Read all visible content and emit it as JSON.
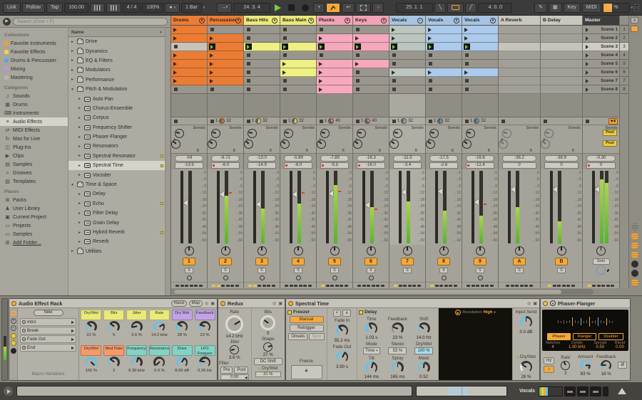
{
  "toolbar": {
    "link": "Link",
    "follow": "Follow",
    "tap": "Tap",
    "tempo": "100.00",
    "time_signature": "4 / 4",
    "groove_amount": "100%",
    "quantization": "1 Bar",
    "arrangement_position": "24. 3. 4",
    "loop_start": "25. 1. 1",
    "loop_length": "4. 0. 0",
    "key_label": "Key",
    "midi_label": "MIDI",
    "cpu_load": "23 %"
  },
  "browser": {
    "search_placeholder": "Search (Cmd + F)",
    "sections": [
      {
        "title": "Collections",
        "items": [
          {
            "label": "Favorite Instruments",
            "swatch": "#f0a030"
          },
          {
            "label": "Favorite Effects",
            "swatch": "#e8d44a"
          },
          {
            "label": "Drums & Percussion",
            "swatch": "#6aa0d8"
          },
          {
            "label": "Mixing",
            "swatch": "#c490e4"
          },
          {
            "label": "Mastering",
            "swatch": "#b8b5ad"
          }
        ]
      },
      {
        "title": "Categories",
        "items": [
          {
            "label": "Sounds",
            "icon": "notes"
          },
          {
            "label": "Drums",
            "icon": "drum-grid"
          },
          {
            "label": "Instruments",
            "icon": "keys"
          },
          {
            "label": "Audio Effects",
            "icon": "audio-fx",
            "selected": true
          },
          {
            "label": "MIDI Effects",
            "icon": "midi-fx"
          },
          {
            "label": "Max for Live",
            "icon": "max"
          },
          {
            "label": "Plug-Ins",
            "icon": "plug"
          },
          {
            "label": "Clips",
            "icon": "clip"
          },
          {
            "label": "Samples",
            "icon": "sample"
          },
          {
            "label": "Grooves",
            "icon": "groove"
          },
          {
            "label": "Templates",
            "icon": "template"
          }
        ]
      },
      {
        "title": "Places",
        "items": [
          {
            "label": "Packs",
            "icon": "pack"
          },
          {
            "label": "User Library",
            "icon": "user"
          },
          {
            "label": "Current Project",
            "icon": "project"
          },
          {
            "label": "Projects",
            "icon": "folder"
          },
          {
            "label": "Samples",
            "icon": "folder"
          },
          {
            "label": "Add Folder...",
            "icon": "add",
            "underline": true
          }
        ]
      }
    ],
    "tree": {
      "header": "Name",
      "items": [
        {
          "label": "Drive",
          "depth": 0,
          "kind": "folder",
          "state": "collapsed"
        },
        {
          "label": "Dynamics",
          "depth": 0,
          "kind": "folder",
          "state": "collapsed"
        },
        {
          "label": "EQ & Filters",
          "depth": 0,
          "kind": "folder",
          "state": "collapsed"
        },
        {
          "label": "Modulators",
          "depth": 0,
          "kind": "folder",
          "state": "collapsed"
        },
        {
          "label": "Performance",
          "depth": 0,
          "kind": "folder",
          "state": "collapsed"
        },
        {
          "label": "Pitch & Modulation",
          "depth": 0,
          "kind": "folder",
          "state": "expanded"
        },
        {
          "label": "Auto Pan",
          "depth": 1,
          "kind": "device",
          "state": "collapsed"
        },
        {
          "label": "Chorus-Ensemble",
          "depth": 1,
          "kind": "device",
          "state": "collapsed"
        },
        {
          "label": "Corpus",
          "depth": 1,
          "kind": "device",
          "state": "collapsed"
        },
        {
          "label": "Frequency Shifter",
          "depth": 1,
          "kind": "device",
          "state": "collapsed"
        },
        {
          "label": "Phaser-Flanger",
          "depth": 1,
          "kind": "device",
          "state": "collapsed"
        },
        {
          "label": "Resonators",
          "depth": 1,
          "kind": "device",
          "state": "collapsed"
        },
        {
          "label": "Spectral Resonator",
          "depth": 1,
          "kind": "device",
          "state": "collapsed",
          "dot": true
        },
        {
          "label": "Spectral Time",
          "depth": 1,
          "kind": "device",
          "state": "collapsed",
          "dot": true,
          "selected": true
        },
        {
          "label": "Vocoder",
          "depth": 1,
          "kind": "device",
          "state": "collapsed"
        },
        {
          "label": "Time & Space",
          "depth": 0,
          "kind": "folder",
          "state": "expanded"
        },
        {
          "label": "Delay",
          "depth": 1,
          "kind": "device",
          "state": "collapsed"
        },
        {
          "label": "Echo",
          "depth": 1,
          "kind": "device",
          "state": "collapsed",
          "dot": true
        },
        {
          "label": "Filter Delay",
          "depth": 1,
          "kind": "device",
          "state": "collapsed"
        },
        {
          "label": "Grain Delay",
          "depth": 1,
          "kind": "device",
          "state": "collapsed"
        },
        {
          "label": "Hybrid Reverb",
          "depth": 1,
          "kind": "device",
          "state": "collapsed",
          "dot": true
        },
        {
          "label": "Reverb",
          "depth": 1,
          "kind": "device",
          "state": "collapsed"
        },
        {
          "label": "Utilities",
          "depth": 0,
          "kind": "folder",
          "state": "collapsed"
        }
      ]
    }
  },
  "session": {
    "scenes": [
      "Scene 1",
      "Scene 2",
      "Scene 3",
      "Scene 4",
      "Scene 5",
      "Scene 6",
      "Scene 7",
      "Scene 8"
    ],
    "selected_scene_index": 2,
    "db_scale": [
      "6",
      "0",
      "6",
      "12",
      "18",
      "24",
      "36",
      "42",
      "48",
      "54",
      "60"
    ],
    "sends_label": "Sends",
    "master_post_labels": [
      "Post",
      "Post"
    ],
    "solo_label": "Solo",
    "tracks": [
      {
        "name": "Drums",
        "kind": "track",
        "color": "#ec7c34",
        "clip_color": "#ec7c34",
        "clips": [
          "c",
          "c",
          "S",
          "c",
          "c",
          "c",
          "c",
          "s"
        ],
        "status": null,
        "peak": "-Inf",
        "volume": "-13.5",
        "vol_dot": false,
        "meter": 0,
        "fader": 0.44,
        "activator": "1",
        "arm": true,
        "dashes_hl": 0
      },
      {
        "name": "Percussion",
        "kind": "track",
        "color": "#ec7c34",
        "clip_color": "#ec7c34",
        "clips": [
          "s",
          "c",
          "g",
          "c",
          "c",
          "c",
          "c",
          "s"
        ],
        "status": {
          "clip": "1",
          "length": "32",
          "color": "#e06a20",
          "progress": 0.55
        },
        "peak": "-6.72",
        "volume": "-6.0",
        "vol_dot": true,
        "meter": 0.66,
        "peak_mark": 0.3,
        "fader": 0.33,
        "activator": "2",
        "arm": true,
        "dashes_hl": 2
      },
      {
        "name": "Bass Hits",
        "kind": "track",
        "color": "#e9e97c",
        "clip_color": "#eef084",
        "clips": [
          "s",
          "s",
          "g",
          "s",
          "s",
          "s",
          "s",
          "s"
        ],
        "status": {
          "clip": "1",
          "length": "32",
          "color": "#ddd355",
          "progress": 0.55
        },
        "peak": "-13.0",
        "volume": "-14.9",
        "vol_dot": false,
        "meter": 0.48,
        "fader": 0.46,
        "activator": "3",
        "arm": true,
        "dashes_hl": 2
      },
      {
        "name": "Bass Main",
        "kind": "track",
        "color": "#e9e97c",
        "clip_color": "#eef084",
        "clips": [
          "s",
          "s",
          "g",
          "s",
          "c",
          "c",
          "s",
          "s"
        ],
        "status": {
          "clip": "1",
          "length": "32",
          "color": "#ddd355",
          "progress": 0.55
        },
        "peak": "-5.89",
        "volume": "-6.0",
        "vol_dot": true,
        "meter": 0.55,
        "peak_mark": 0.3,
        "fader": 0.33,
        "activator": "4",
        "arm": true,
        "dashes_hl": 0
      },
      {
        "name": "Plucks",
        "kind": "track",
        "color": "#f2a2b6",
        "clip_color": "#f6a8bc",
        "clips": [
          "s",
          "c",
          "g",
          "s",
          "c",
          "c",
          "c",
          "c"
        ],
        "status": {
          "clip": "1",
          "length": "40",
          "color": "#e87a96",
          "progress": 0.35
        },
        "peak": "-7.89",
        "volume": "-5.5",
        "vol_dot": true,
        "meter": 0.8,
        "peak_mark": 0.28,
        "fader": 0.32,
        "activator": "5",
        "arm": true,
        "dashes_hl": 1
      },
      {
        "name": "Keys",
        "kind": "track",
        "color": "#f2a2b6",
        "clip_color": "#f6a8bc",
        "clips": [
          "s",
          "c",
          "g",
          "s",
          "c",
          "s",
          "s",
          "s"
        ],
        "status": {
          "clip": "1",
          "length": "40",
          "color": "#e87a96",
          "progress": 0.35
        },
        "peak": "-16.3",
        "volume": "-16.0",
        "vol_dot": true,
        "meter": 0.5,
        "peak_mark": 0.52,
        "fader": 0.47,
        "activator": "6",
        "arm": true,
        "dashes_hl": 0
      },
      {
        "name": "Vocals",
        "kind": "group",
        "color": "#a6c4e2",
        "clip_color": "#bcc6c0",
        "hatch": true,
        "clips": [
          "c",
          "c",
          "g",
          "s",
          "s",
          "c",
          "s",
          "s"
        ],
        "status": {
          "clip": "1",
          "length": "32",
          "color": "#8fa8ba",
          "progress": 0.55
        },
        "peak": "-11.5",
        "volume": "-3.4",
        "vol_dot": false,
        "meter": 0.58,
        "fader": 0.3,
        "activator": "7",
        "arm": false,
        "dashes_hl": 1,
        "selected": true
      },
      {
        "name": "Vocals",
        "kind": "track",
        "color": "#a6c4e2",
        "clip_color": "#abcaec",
        "clips": [
          "c",
          "c",
          "g",
          "s",
          "s",
          "c",
          "s",
          "s"
        ],
        "status": {
          "clip": "1",
          "length": "32",
          "color": "#5f93c8",
          "progress": 0.5
        },
        "peak": "-17.5",
        "volume": "-2.6",
        "vol_dot": false,
        "meter": 0.45,
        "fader": 0.29,
        "activator": "8",
        "arm": true,
        "dashes_hl": 1
      },
      {
        "name": "Vocals",
        "kind": "track",
        "color": "#a6c4e2",
        "clip_color": "#abcaec",
        "clips": [
          "c",
          "c",
          "g",
          "s",
          "s",
          "c",
          "s",
          "s"
        ],
        "status": {
          "clip": "1",
          "length": "32",
          "color": "#5f93c8",
          "progress": 0.5
        },
        "peak": "-16.6",
        "volume": "-12.4",
        "vol_dot": true,
        "meter": 0.38,
        "peak_mark": 0.45,
        "fader": 0.43,
        "activator": "9",
        "arm": true,
        "dashes_hl": 0
      },
      {
        "name": "A Reverb",
        "kind": "return",
        "color": "#c9c6be",
        "clips": [],
        "status": null,
        "peak": "-36.2",
        "volume": "0",
        "vol_dot": false,
        "meter": 0.5,
        "fader": 0.26,
        "activator": "A",
        "arm": false,
        "dashes_hl": 0
      },
      {
        "name": "B Delay",
        "kind": "return",
        "color": "#c9c6be",
        "clips": [],
        "status": null,
        "peak": "-38.9",
        "volume": "0",
        "vol_dot": false,
        "meter": 0.3,
        "fader": 0.26,
        "activator": "B",
        "arm": false,
        "dashes_hl": 1
      },
      {
        "name": "Master",
        "kind": "master",
        "color": "#3d3d3d",
        "clips": [],
        "status": null,
        "peak": "-0.30",
        "volume": "0",
        "vol_dot": true,
        "meter": 0.88,
        "fader": 0.26,
        "activator": "",
        "arm": false,
        "dashes_hl": 1
      }
    ]
  },
  "devices": {
    "rack": {
      "title": "Audio Effect Rack",
      "rand_button": "Rand",
      "map_button": "Map",
      "new_button": "New",
      "variations_label": "Macro Variations",
      "variations": [
        "Intro",
        "Break",
        "Fade Out",
        "End"
      ],
      "macros": [
        {
          "label": "Dry/Wet",
          "value": "31 %",
          "color": "#e9e97c",
          "frac": 0.31
        },
        {
          "label": "Bits",
          "value": "5",
          "color": "#e9e97c",
          "frac": 0.3
        },
        {
          "label": "Jitter",
          "value": "3.6 %",
          "color": "#e9e97c",
          "frac": 0.12
        },
        {
          "label": "Rate",
          "value": "14.2 kHz",
          "color": "#e9e97c",
          "frac": 0.72
        },
        {
          "label": "Dry Wet",
          "value": "28 %",
          "color": "#c2a4e6",
          "frac": 0.28
        },
        {
          "label": "Feedback",
          "value": "23 %",
          "color": "#c2a4e6",
          "frac": 0.23
        },
        {
          "label": "Dry/Wet",
          "value": "100 %",
          "color": "#f59a68",
          "frac": 1
        },
        {
          "label": "Mod Rate",
          "value": "2",
          "color": "#f59a68",
          "frac": 0.3
        },
        {
          "label": "Frequency",
          "value": "6.30 kHz",
          "color": "#84d2c4",
          "frac": 0.55
        },
        {
          "label": "Resonance",
          "value": "0.0 %",
          "color": "#84d2c4",
          "frac": 0
        },
        {
          "label": "Drive",
          "value": "8.69 dB",
          "color": "#84d2c4",
          "frac": 0.62
        },
        {
          "label": "LFO Frequen",
          "value": "0.26 Hz",
          "color": "#84d2c4",
          "frac": 0.2
        }
      ]
    },
    "redux": {
      "title": "Redux",
      "rate_label": "Rate",
      "rate_value": "14.2 kHz",
      "jitter_label": "Jitter",
      "jitter_value": "3.6 %",
      "filter_label": "Filter",
      "pre_button": "Pre",
      "post_button": "Post",
      "filter_freq": "0.00",
      "bits_label": "Bits",
      "bits_value": "5",
      "shape_label": "Shape",
      "shape_value": "27 %",
      "dc_shift_button": "DC Shift",
      "dry_wet_label": "Dry/Wet",
      "dry_wet_value": "31 %"
    },
    "spectral_time": {
      "title": "Spectral Time",
      "freezer_label": "Freezer",
      "manual_button": "Manual",
      "retrigger_button": "Retrigger",
      "onsets_button": "Onsets",
      "sync_button": "Sync",
      "fade_in_label": "Fade In",
      "fade_in_value": "55.2 ms",
      "fade_out_label": "Fade Out",
      "fade_out_value": "3.90 s",
      "freeze_label": "Freeze",
      "delay_label": "Delay",
      "time_label": "Time",
      "time_value": "1.03 s",
      "feedback_label": "Feedback",
      "feedback_value": "23 %",
      "shift_label": "Shift",
      "shift_value": "14.0 Hz",
      "mode_label": "Mode",
      "mode_value": "Time",
      "stereo_label": "Stereo",
      "stereo_value": "53 %",
      "dry_wet_label": "Dry/Wet",
      "dry_wet_value": "100 %",
      "tilt_label": "Tilt",
      "tilt_value": "144 ms",
      "spray_label": "Spray",
      "spray_value": "165 ms",
      "mask_label": "Mask",
      "mask_value": "0.52",
      "resolution_label": "Resolution",
      "resolution_value": "High",
      "input_send_label": "Input Send",
      "input_send_value": "0.0 dB",
      "output_dry_wet_label": "Dry/Wet",
      "output_dry_wet_value": "28 %"
    },
    "phaser_flanger": {
      "title": "Phaser-Flanger",
      "mode_buttons": [
        "Phaser",
        "Flanger",
        "Doubler"
      ],
      "active_mode": "Phaser",
      "param_labels": [
        "Notches",
        "Center",
        "Spread",
        "Blend"
      ],
      "param_values": [
        "4",
        "1.00 kHz",
        "0.50",
        "0.00"
      ],
      "hz_button": "Hz",
      "note_button": "♪",
      "rate_label": "Rate",
      "rate_value": "2",
      "amount_label": "Amount",
      "amount_value": "83 %",
      "feedback_label": "Feedback",
      "feedback_value": "16 %",
      "invert_button": "Ø",
      "bars": [
        {
          "h": 4
        },
        {
          "h": 3
        },
        {
          "h": 5
        },
        {
          "h": 3
        },
        {
          "h": 4
        },
        {
          "h": 12,
          "c": "#e8a13c"
        },
        {
          "h": 4
        },
        {
          "h": 3
        },
        {
          "h": 10,
          "c": "#6db8e8"
        },
        {
          "h": 3
        },
        {
          "h": 4
        },
        {
          "h": 14,
          "c": "#e8a13c"
        },
        {
          "h": 3
        },
        {
          "h": 5
        },
        {
          "h": 12,
          "c": "#6db8e8"
        },
        {
          "h": 4
        },
        {
          "h": 3
        },
        {
          "h": 10,
          "c": "#e8a13c"
        },
        {
          "h": 4
        },
        {
          "h": 3
        }
      ]
    }
  },
  "status_bar": {
    "selected_track": "Vocals"
  }
}
